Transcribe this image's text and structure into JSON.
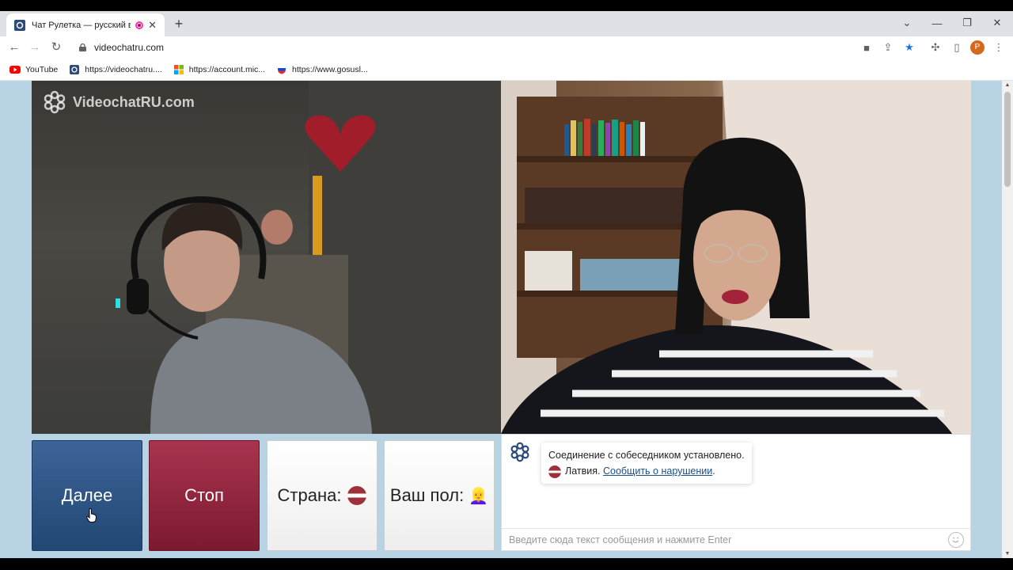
{
  "browser": {
    "tab_title": "Чат Рулетка — русский вид",
    "url": "videochatru.com",
    "bookmarks": [
      {
        "label": "YouTube",
        "icon": "youtube-icon"
      },
      {
        "label": "https://videochatru....",
        "icon": "site-icon"
      },
      {
        "label": "https://account.mic...",
        "icon": "microsoft-icon"
      },
      {
        "label": "https://www.gosusl...",
        "icon": "gosuslugi-icon"
      }
    ],
    "profile_initial": "P"
  },
  "page": {
    "logo_text": "VideochatRU.com",
    "buttons": {
      "next": "Далее",
      "stop": "Стоп",
      "country": "Страна:",
      "gender": "Ваш пол:",
      "gender_emoji": "👱‍♀️"
    },
    "chat": {
      "system_message": "Соединение с собеседником установлено.",
      "country_name": "Латвия.",
      "report_link": "Сообщить о нарушении",
      "report_suffix": ".",
      "input_placeholder": "Введите сюда текст сообщения и нажмите Enter"
    }
  },
  "colors": {
    "next_button": "#2d5688",
    "stop_button": "#8e2540",
    "page_background": "#b8d4e4"
  }
}
